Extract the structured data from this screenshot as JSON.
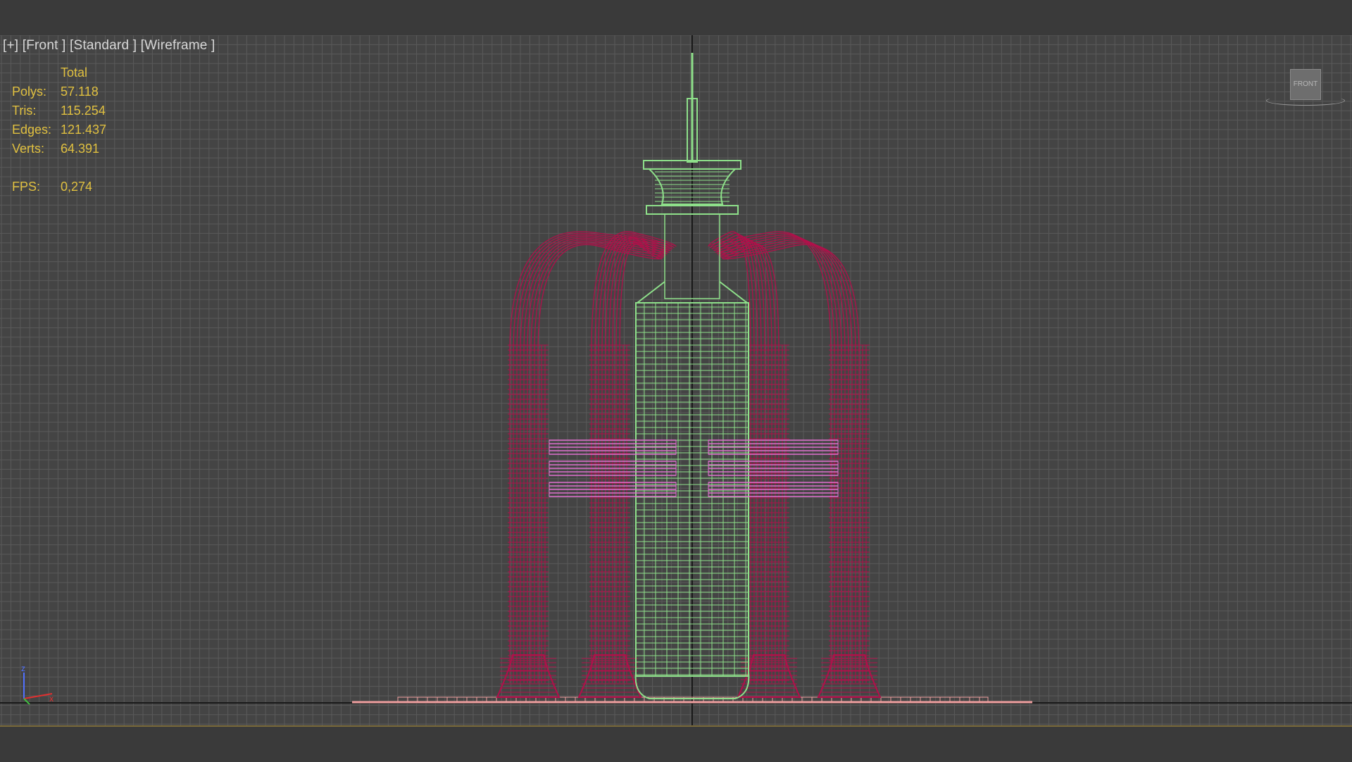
{
  "viewport": {
    "label_parts": [
      "[+]",
      "[Front ]",
      "[Standard ]",
      "[Wireframe ]"
    ]
  },
  "stats": {
    "header": "Total",
    "rows": [
      {
        "key": "Polys:",
        "value": "57.118"
      },
      {
        "key": "Tris:",
        "value": "115.254"
      },
      {
        "key": "Edges:",
        "value": "121.437"
      },
      {
        "key": "Verts:",
        "value": "64.391"
      }
    ],
    "fps_key": "FPS:",
    "fps_value": "0,274"
  },
  "viewcube": {
    "label": "FRONT"
  },
  "axis": {
    "z_label": "z",
    "x_label": "x"
  },
  "colors": {
    "background": "#444444",
    "grid": "#5a5a5a",
    "stats_text": "#e0c040",
    "arches": "#b0104a",
    "spire": "#8ee08a",
    "bars": "#e070d0",
    "ground": "#f0a0a0"
  }
}
